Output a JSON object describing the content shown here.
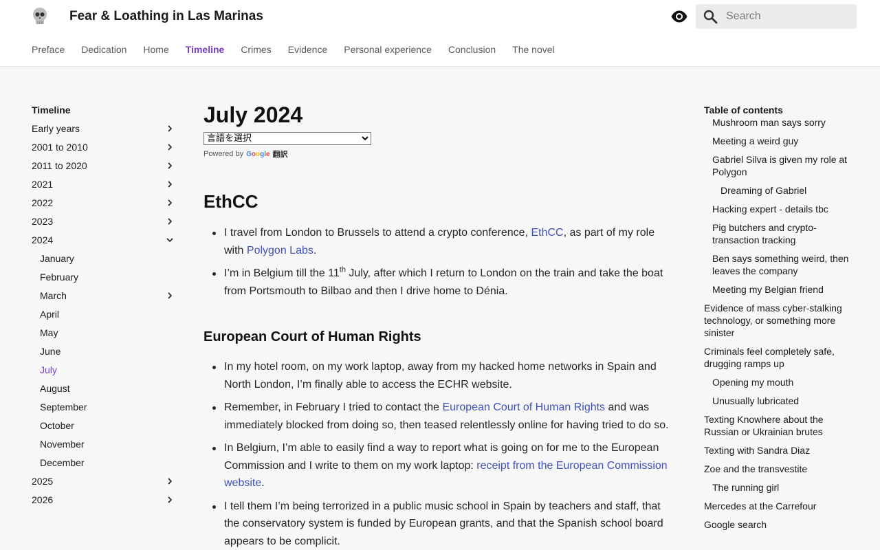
{
  "header": {
    "site_title": "Fear & Loathing in Las Marinas",
    "logo_icon": "skull-icon",
    "search_placeholder": "Search",
    "accent_color": "#7a3fc5",
    "tabs": [
      {
        "label": "Preface",
        "active": false
      },
      {
        "label": "Dedication",
        "active": false
      },
      {
        "label": "Home",
        "active": false
      },
      {
        "label": "Timeline",
        "active": true
      },
      {
        "label": "Crimes",
        "active": false
      },
      {
        "label": "Evidence",
        "active": false
      },
      {
        "label": "Personal experience",
        "active": false
      },
      {
        "label": "Conclusion",
        "active": false
      },
      {
        "label": "The novel",
        "active": false
      }
    ]
  },
  "sidebar": {
    "title": "Timeline",
    "items": [
      {
        "label": "Early years",
        "chevron": "right"
      },
      {
        "label": "2001 to 2010",
        "chevron": "right"
      },
      {
        "label": "2011 to 2020",
        "chevron": "right"
      },
      {
        "label": "2021",
        "chevron": "right"
      },
      {
        "label": "2022",
        "chevron": "right"
      },
      {
        "label": "2023",
        "chevron": "right"
      },
      {
        "label": "2024",
        "chevron": "down"
      },
      {
        "label": "January",
        "sub": true
      },
      {
        "label": "February",
        "sub": true
      },
      {
        "label": "March",
        "sub": true,
        "chevron": "right"
      },
      {
        "label": "April",
        "sub": true
      },
      {
        "label": "May",
        "sub": true
      },
      {
        "label": "June",
        "sub": true
      },
      {
        "label": "July",
        "sub": true,
        "active": true
      },
      {
        "label": "August",
        "sub": true
      },
      {
        "label": "September",
        "sub": true
      },
      {
        "label": "October",
        "sub": true
      },
      {
        "label": "November",
        "sub": true
      },
      {
        "label": "December",
        "sub": true
      },
      {
        "label": "2025",
        "chevron": "right"
      },
      {
        "label": "2026",
        "chevron": "right"
      }
    ]
  },
  "main": {
    "title": "July 2024",
    "language_select": "言語を選択",
    "powered_by": "Powered by",
    "google_logo": {
      "G": "G",
      "o1": "o",
      "o2": "o",
      "g": "g",
      "l": "l",
      "e": "e"
    },
    "translate_word": "翻訳",
    "ethcc": {
      "heading": "EthCC",
      "b1_pre": "I travel from London to Brussels to attend a crypto conference, ",
      "b1_link1": "EthCC",
      "b1_mid": ", as part of my role with ",
      "b1_link2": "Polygon Labs",
      "b1_post": ".",
      "b2_pre": "I’m in Belgium till the 11",
      "b2_sup": "th",
      "b2_post": " July, after which I return to London on the train and take the boat from Portsmouth to Bilbao and then I drive home to Dénia."
    },
    "echr": {
      "heading": "European Court of Human Rights",
      "b1": "In my hotel room, on my work laptop, away from my hacked home networks in Spain and North London, I’m finally able to access the ECHR website.",
      "b2_pre": "Remember, in February I tried to contact the ",
      "b2_link": "European Court of Human Rights",
      "b2_post": " and was immediately blocked from doing so, then teased relentlessly online for having tried to do so.",
      "b3_pre": "In Belgium, I’m able to easily find a way to report what is going on for me to the European Commission and I write to them on my work laptop: ",
      "b3_link": "receipt from the European Commission website",
      "b3_post": ".",
      "b4": "I tell them I’m being terrorized in a public music school in Spain by teachers and staff, that the conservatory system is funded by European grants, and that the Spanish school board appears to be complicit."
    }
  },
  "toc": {
    "title": "Table of contents",
    "items": [
      {
        "label": "Mushroom man says sorry",
        "level": 2
      },
      {
        "label": "Meeting a weird guy",
        "level": 2
      },
      {
        "label": "Gabriel Silva is given my role at Polygon",
        "level": 2
      },
      {
        "label": "Dreaming of Gabriel",
        "level": 3
      },
      {
        "label": "Hacking expert - details tbc",
        "level": 2
      },
      {
        "label": "Pig butchers and crypto-transaction tracking",
        "level": 2
      },
      {
        "label": "Ben says something weird, then leaves the company",
        "level": 2
      },
      {
        "label": "Meeting my Belgian friend",
        "level": 2
      },
      {
        "label": "Evidence of mass cyber-stalking technology, or something more sinister",
        "level": 1
      },
      {
        "label": "Criminals feel completely safe, drugging ramps up",
        "level": 1
      },
      {
        "label": "Opening my mouth",
        "level": 2
      },
      {
        "label": "Unusually lubricated",
        "level": 2
      },
      {
        "label": "Texting Knowhere about the Russian or Ukrainian brutes",
        "level": 1
      },
      {
        "label": "Texting with Sandra Diaz",
        "level": 1
      },
      {
        "label": "Zoe and the transvestite",
        "level": 1
      },
      {
        "label": "The running girl",
        "level": 2
      },
      {
        "label": "Mercedes at the Carrefour",
        "level": 1
      },
      {
        "label": "Google search",
        "level": 1
      }
    ]
  }
}
